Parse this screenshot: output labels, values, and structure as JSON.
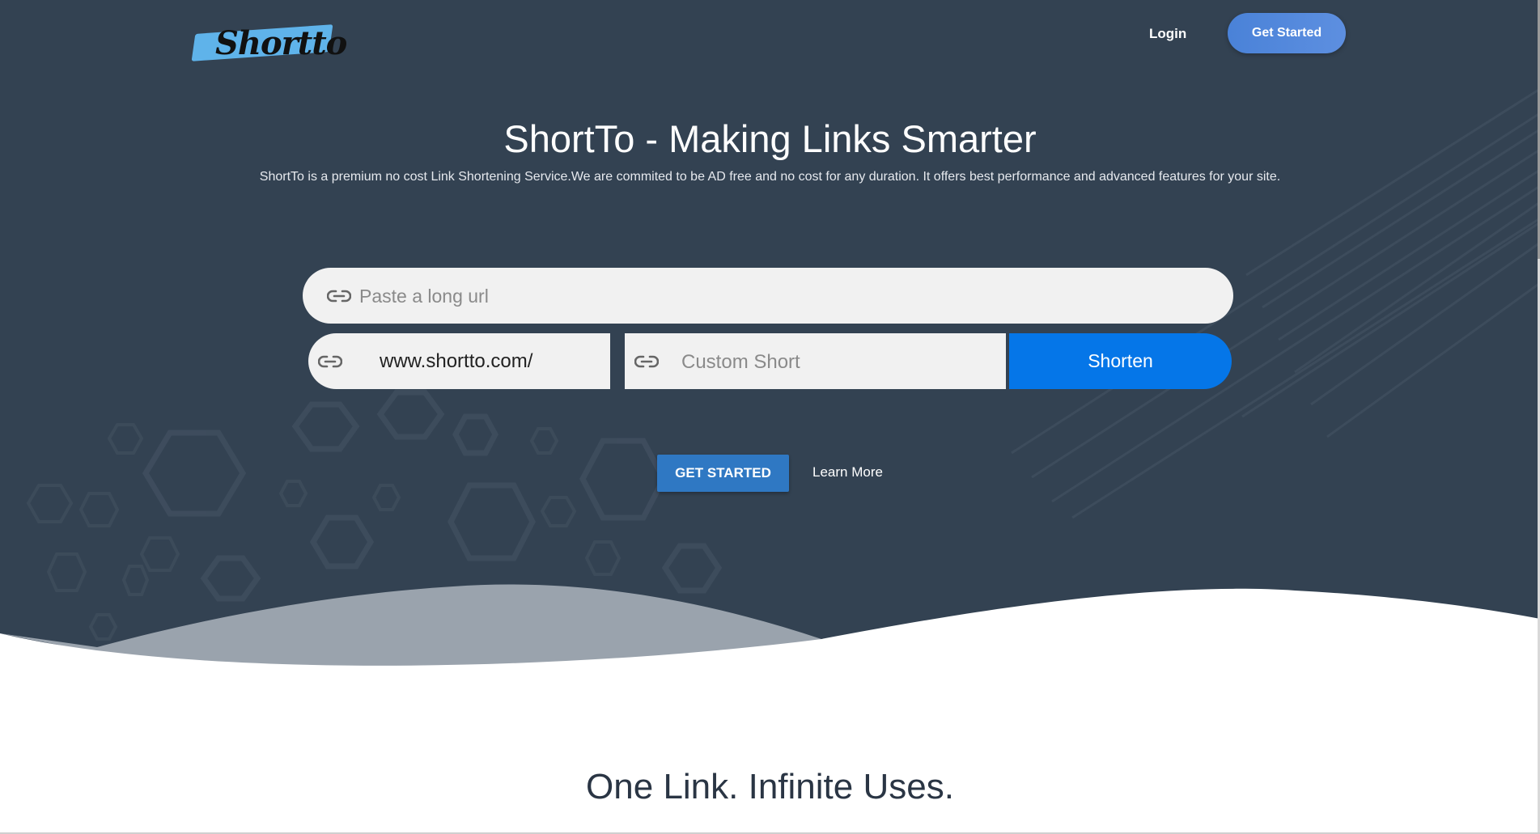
{
  "header": {
    "logo_text": "Shortto",
    "login_label": "Login",
    "cta_label": "Get Started"
  },
  "hero": {
    "title": "ShortTo - Making Links Smarter",
    "subtitle": "ShortTo is a premium no cost Link Shortening Service.We are commited to be AD free and no cost for any duration. It offers best performance and advanced features for your site."
  },
  "shortener": {
    "url_placeholder": "Paste a long url",
    "domain_prefix": "www.shortto.com/",
    "custom_placeholder": "Custom Short",
    "shorten_label": "Shorten"
  },
  "actions": {
    "get_started_label": "GET STARTED",
    "learn_more_label": "Learn More"
  },
  "section": {
    "title": "One Link. Infinite Uses."
  },
  "colors": {
    "hero_bg": "#334252",
    "primary_blue": "#0576e8",
    "cta_blue": "#4a82d8",
    "get_started_blue": "#2f78c3",
    "input_bg": "#f1f1f1"
  }
}
